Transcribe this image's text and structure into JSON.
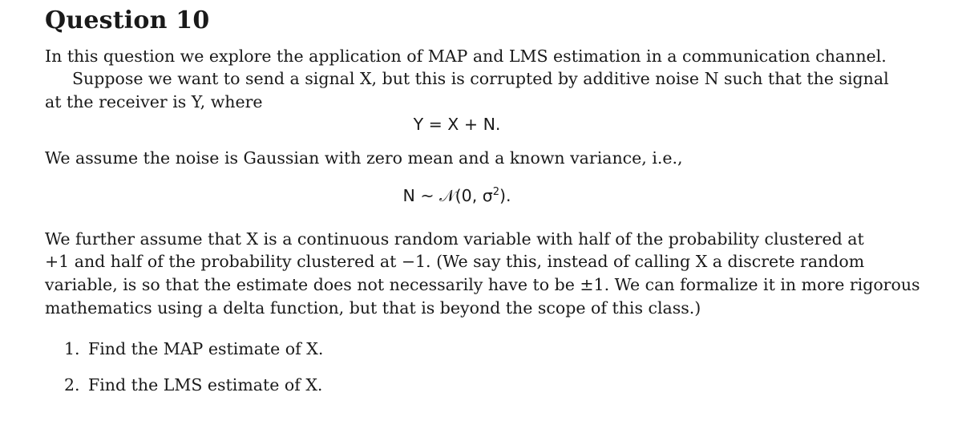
{
  "document": {
    "heading": "Question 10",
    "paragraphs": {
      "intro": "In this question we explore the application of MAP and LMS estimation in a communication channel.",
      "setup_line1": "Suppose we want to send a signal X, but this is corrupted by additive noise N such that the signal",
      "setup_line2": "at the receiver is Y, where",
      "equation_1": "Y = X + N.",
      "noise_text": "We assume the noise is Gaussian with zero mean and a known variance, i.e.,",
      "equation_2_lhs": "N ~ 𝒩(0, σ",
      "equation_2_sup": "2",
      "equation_2_rhs": ").",
      "assume_line1": "We further assume that X is a continuous random variable with half of the probability clustered at",
      "assume_line2": "+1 and half of the probability clustered at −1.  (We say this, instead of calling X a discrete random",
      "assume_line3": "variable, is so that the estimate does not necessarily have to be ±1.  We can formalize it in more rigorous",
      "assume_line4": "mathematics using a delta function, but that is beyond the scope of this class.)"
    },
    "questions": [
      {
        "number": "1.",
        "text": "Find the MAP estimate of X."
      },
      {
        "number": "2.",
        "text": "Find the LMS estimate of X."
      }
    ]
  }
}
